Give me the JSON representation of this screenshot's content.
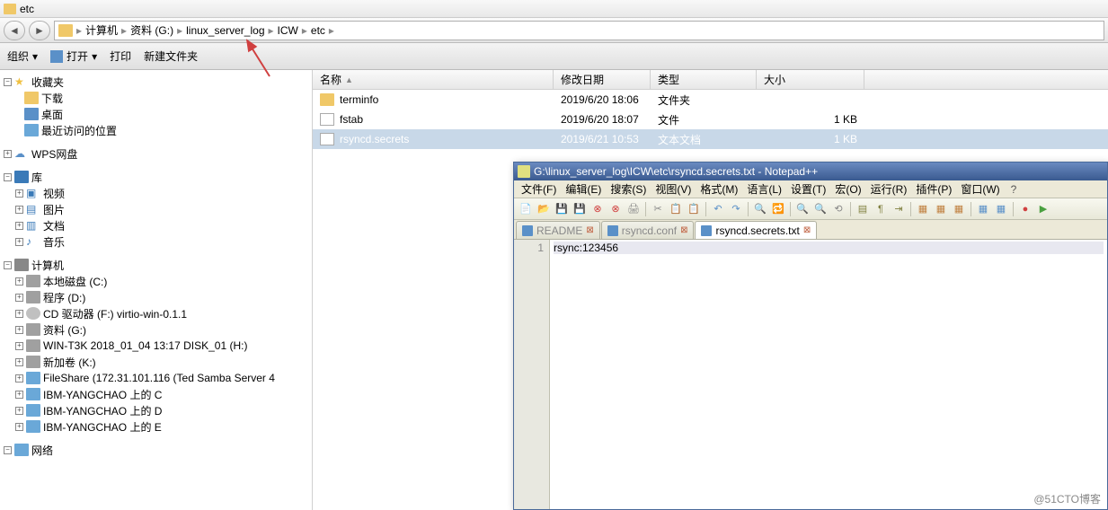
{
  "window_title": "etc",
  "breadcrumb": [
    "计算机",
    "资料 (G:)",
    "linux_server_log",
    "ICW",
    "etc"
  ],
  "toolbar": {
    "organize": "组织",
    "open": "打开",
    "print": "打印",
    "new_folder": "新建文件夹"
  },
  "columns": {
    "name": "名称",
    "date": "修改日期",
    "type": "类型",
    "size": "大小"
  },
  "files": [
    {
      "name": "terminfo",
      "date": "2019/6/20 18:06",
      "type": "文件夹",
      "size": "",
      "icon": "folder"
    },
    {
      "name": "fstab",
      "date": "2019/6/20 18:07",
      "type": "文件",
      "size": "1 KB",
      "icon": "file"
    },
    {
      "name": "rsyncd.secrets",
      "date": "2019/6/21 10:53",
      "type": "文本文档",
      "size": "1 KB",
      "icon": "txt",
      "selected": true
    }
  ],
  "sidebar": {
    "favorites": {
      "label": "收藏夹",
      "items": [
        "下载",
        "桌面",
        "最近访问的位置"
      ]
    },
    "wps": "WPS网盘",
    "library": {
      "label": "库",
      "items": [
        "视频",
        "图片",
        "文档",
        "音乐"
      ]
    },
    "computer": {
      "label": "计算机",
      "items": [
        "本地磁盘 (C:)",
        "程序 (D:)",
        "CD 驱动器 (F:) virtio-win-0.1.1",
        "资料 (G:)",
        "WIN-T3K 2018_01_04 13:17 DISK_01 (H:)",
        "新加卷 (K:)",
        "FileShare (172.31.101.116 (Ted Samba Server 4",
        "IBM-YANGCHAO 上的 C",
        "IBM-YANGCHAO 上的 D",
        "IBM-YANGCHAO 上的 E"
      ]
    },
    "network": "网络"
  },
  "notepad": {
    "title": "G:\\linux_server_log\\ICW\\etc\\rsyncd.secrets.txt - Notepad++",
    "menus": [
      "文件(F)",
      "编辑(E)",
      "搜索(S)",
      "视图(V)",
      "格式(M)",
      "语言(L)",
      "设置(T)",
      "宏(O)",
      "运行(R)",
      "插件(P)",
      "窗口(W)"
    ],
    "tabs": [
      "README",
      "rsyncd.conf",
      "rsyncd.secrets.txt"
    ],
    "active_tab": 2,
    "line_num": "1",
    "content": "rsync:123456"
  },
  "watermark": "@51CTO博客"
}
